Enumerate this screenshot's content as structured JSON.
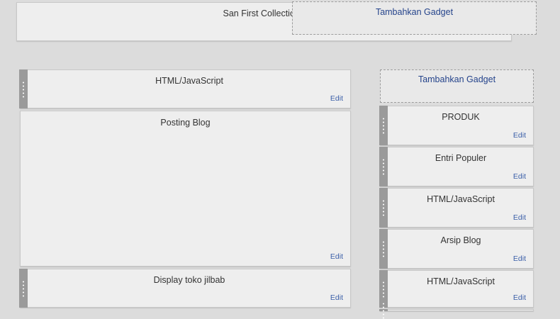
{
  "header": {
    "title": "San First Collection (",
    "add_gadget": "Tambahkan Gadget"
  },
  "main": [
    {
      "title": "HTML/JavaScript",
      "edit": "Edit"
    },
    {
      "title": "Posting Blog",
      "edit": "Edit"
    },
    {
      "title": "Display toko jilbab",
      "edit": "Edit"
    }
  ],
  "sidebar": {
    "add_gadget": "Tambahkan Gadget",
    "items": [
      {
        "title": "PRODUK",
        "edit": "Edit"
      },
      {
        "title": "Entri Populer",
        "edit": "Edit"
      },
      {
        "title": "HTML/JavaScript",
        "edit": "Edit"
      },
      {
        "title": "Arsip Blog",
        "edit": "Edit"
      },
      {
        "title": "HTML/JavaScript",
        "edit": "Edit"
      }
    ]
  }
}
